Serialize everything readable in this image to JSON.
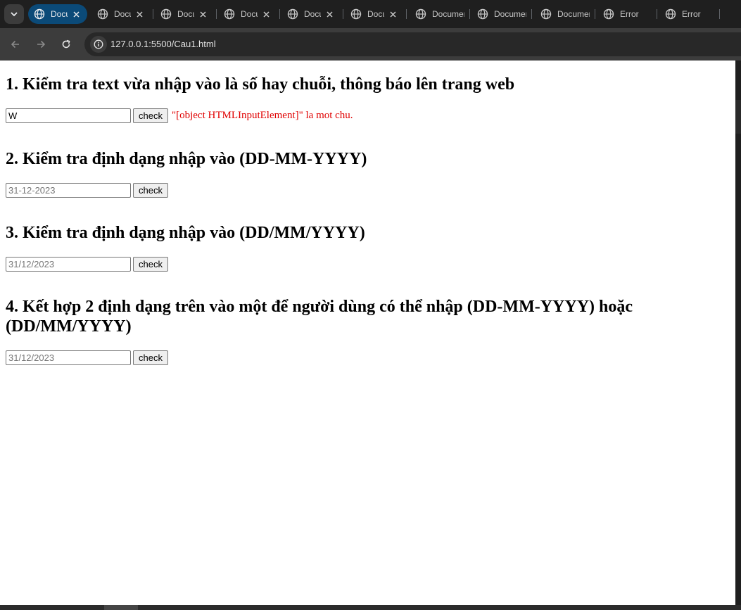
{
  "browser": {
    "tabs": [
      {
        "title": "Document",
        "active": true,
        "closable": true
      },
      {
        "title": "Document",
        "active": false,
        "closable": true
      },
      {
        "title": "Document",
        "active": false,
        "closable": true
      },
      {
        "title": "Document",
        "active": false,
        "closable": true
      },
      {
        "title": "Document",
        "active": false,
        "closable": true
      },
      {
        "title": "Document",
        "active": false,
        "closable": true
      },
      {
        "title": "Document",
        "active": false,
        "closable": false
      },
      {
        "title": "Document",
        "active": false,
        "closable": false
      },
      {
        "title": "Document",
        "active": false,
        "closable": false
      },
      {
        "title": "Error",
        "active": false,
        "closable": false
      },
      {
        "title": "Error",
        "active": false,
        "closable": false
      }
    ],
    "url": "127.0.0.1:5500/Cau1.html",
    "colors": {
      "active_tab": "#0b4a78",
      "tab_strip": "#1f1f1f",
      "toolbar": "#3c3c3c"
    }
  },
  "page": {
    "sections": [
      {
        "title": "1. Kiểm tra text vừa nhập vào là số hay chuỗi, thông báo lên trang web",
        "input_value": "W",
        "input_placeholder": "",
        "button_label": "check",
        "result": "\"[object HTMLInputElement]\" la mot chu."
      },
      {
        "title": "2. Kiểm tra định dạng nhập vào (DD-MM-YYYY)",
        "input_value": "",
        "input_placeholder": "31-12-2023",
        "button_label": "check",
        "result": ""
      },
      {
        "title": "3. Kiểm tra định dạng nhập vào (DD/MM/YYYY)",
        "input_value": "",
        "input_placeholder": "31/12/2023",
        "button_label": "check",
        "result": ""
      },
      {
        "title": "4. Kết hợp 2 định dạng trên vào một để người dùng có thể nhập (DD-MM-YYYY) hoặc (DD/MM/YYYY)",
        "input_value": "",
        "input_placeholder": "31/12/2023",
        "button_label": "check",
        "result": ""
      }
    ],
    "colors": {
      "result_text": "#e00000"
    }
  }
}
